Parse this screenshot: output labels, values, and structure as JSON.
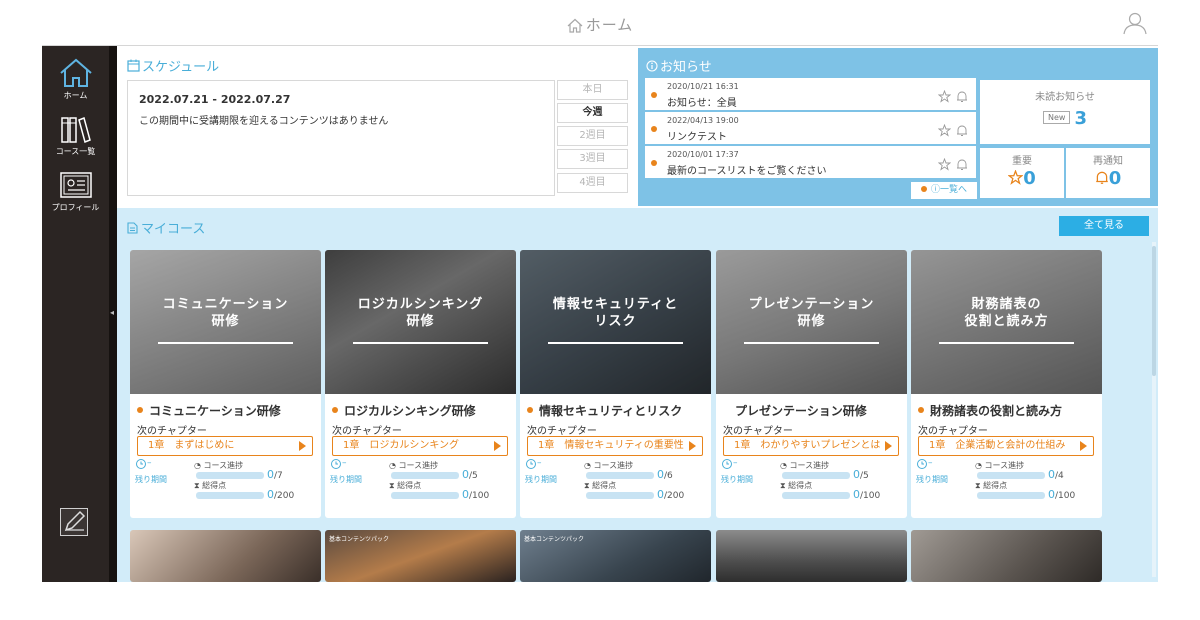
{
  "header": {
    "title": "ホーム"
  },
  "sidebar": {
    "items": [
      {
        "label": "ホーム",
        "icon": "home-icon"
      },
      {
        "label": "コース一覧",
        "icon": "books-icon"
      },
      {
        "label": "プロフィール",
        "icon": "profile-card-icon"
      }
    ]
  },
  "schedule": {
    "title": "スケジュール",
    "range": "2022.07.21 - 2022.07.27",
    "message": "この期間中に受講期限を迎えるコンテンツはありません",
    "tabs": [
      "本日",
      "今週",
      "2週目",
      "3週目",
      "4週目"
    ],
    "active_tab": "今週"
  },
  "news": {
    "title": "お知らせ",
    "items": [
      {
        "date": "2020/10/21 16:31",
        "subject": "お知らせ：全員"
      },
      {
        "date": "2022/04/13 19:00",
        "subject": "リンクテスト"
      },
      {
        "date": "2020/10/01 17:37",
        "subject": "最新のコースリストをご覧ください"
      }
    ],
    "more_label": "一覧へ",
    "unread_label": "未読お知らせ",
    "new_badge": "New",
    "unread_count": "3",
    "important_label": "重要",
    "important_count": "0",
    "renotify_label": "再通知",
    "renotify_count": "0"
  },
  "mycourse": {
    "title": "マイコース",
    "see_all_label": "全て見る",
    "next_chapter_label": "次のチャプター",
    "remaining_label": "残り期間",
    "remaining_value": "–",
    "progress_label": "コース進捗",
    "score_label": "総得点",
    "courses": [
      {
        "caption": "コミュニケーション\n研修",
        "name": "コミュニケーション研修",
        "chapter": "1章　まずはじめに",
        "progress": "0",
        "progress_total": "/7",
        "score": "0",
        "score_total": "/200",
        "has_dot": true
      },
      {
        "caption": "ロジカルシンキング\n研修",
        "name": "ロジカルシンキング研修",
        "chapter": "1章　ロジカルシンキング",
        "progress": "0",
        "progress_total": "/5",
        "score": "0",
        "score_total": "/100",
        "has_dot": true
      },
      {
        "caption": "情報セキュリティと\nリスク",
        "name": "情報セキュリティとリスク",
        "chapter": "1章　情報セキュリティの重要性",
        "progress": "0",
        "progress_total": "/6",
        "score": "0",
        "score_total": "/200",
        "has_dot": true
      },
      {
        "caption": "プレゼンテーション\n研修",
        "name": "プレゼンテーション研修",
        "chapter": "1章　わかりやすいプレゼンとは",
        "progress": "0",
        "progress_total": "/5",
        "score": "0",
        "score_total": "/100",
        "has_dot": false
      },
      {
        "caption": "財務諸表の\n役割と読み方",
        "name": "財務諸表の役割と読み方",
        "chapter": "1章　企業活動と会計の仕組み",
        "progress": "0",
        "progress_total": "/4",
        "score": "0",
        "score_total": "/100",
        "has_dot": true
      }
    ],
    "row2_tag": "基本コンテンツパック"
  },
  "colors": {
    "accent_blue": "#49aed8",
    "news_bg": "#7ec2e6",
    "mycourse_bg": "#d2ecf9",
    "orange": "#e8841c",
    "sidebar_bg": "#2b2523"
  }
}
